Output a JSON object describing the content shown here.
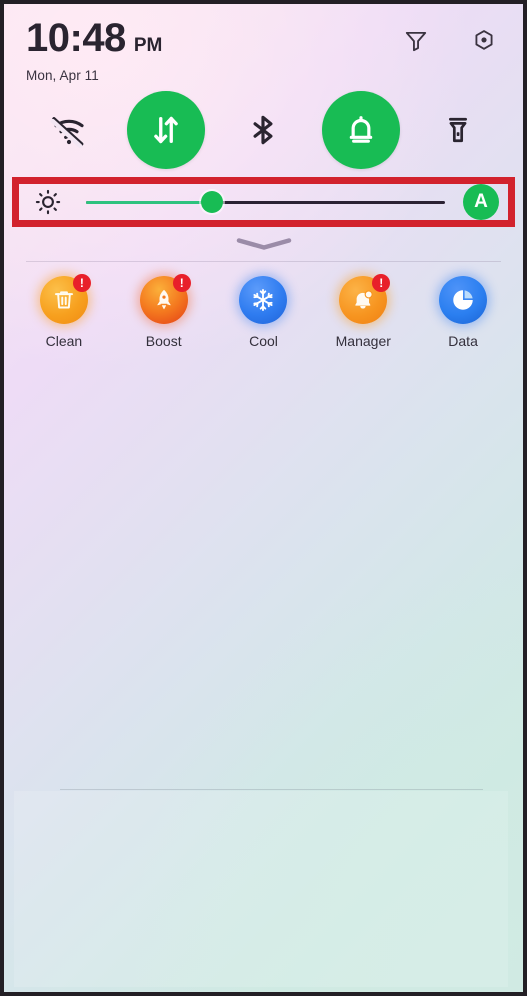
{
  "status_bar": {
    "time": "10:48",
    "ampm": "PM",
    "date": "Mon, Apr 11",
    "actions": [
      {
        "name": "filter-icon",
        "label": "Filter notifications"
      },
      {
        "name": "settings-icon",
        "label": "Settings"
      }
    ]
  },
  "quick_toggles": [
    {
      "id": "wifi",
      "label": "Wi-Fi",
      "state": "off",
      "icon": "wifi-off-icon"
    },
    {
      "id": "mobiledata",
      "label": "Mobile data",
      "state": "on",
      "icon": "mobile-data-icon"
    },
    {
      "id": "bluetooth",
      "label": "Bluetooth",
      "state": "off",
      "icon": "bluetooth-icon"
    },
    {
      "id": "sound",
      "label": "Sound",
      "state": "on",
      "icon": "bell-icon"
    },
    {
      "id": "flashlight",
      "label": "Flashlight",
      "state": "off",
      "icon": "flashlight-icon"
    }
  ],
  "brightness": {
    "icon": "brightness-sun-icon",
    "value_percent": 35,
    "auto_label": "A",
    "auto_enabled": true,
    "annotation_color": "#d2222d"
  },
  "panel": {
    "expand_handle": "chevron-down-handle"
  },
  "shortcuts": [
    {
      "label": "Clean",
      "icon": "trash-icon",
      "badge": "!",
      "color": "#f7a01e"
    },
    {
      "label": "Boost",
      "icon": "rocket-icon",
      "badge": "!",
      "color": "#f2651c"
    },
    {
      "label": "Cool",
      "icon": "snowflake-icon",
      "badge": "",
      "color": "#3b82f6"
    },
    {
      "label": "Manager",
      "icon": "bell-alert-icon",
      "badge": "!",
      "color": "#f79520"
    },
    {
      "label": "Data",
      "icon": "pie-chart-icon",
      "badge": "",
      "color": "#2b7ff0"
    }
  ],
  "theme": {
    "accent_green": "#18bc54",
    "badge_red": "#e8202a",
    "text_dark": "#2a2430"
  }
}
